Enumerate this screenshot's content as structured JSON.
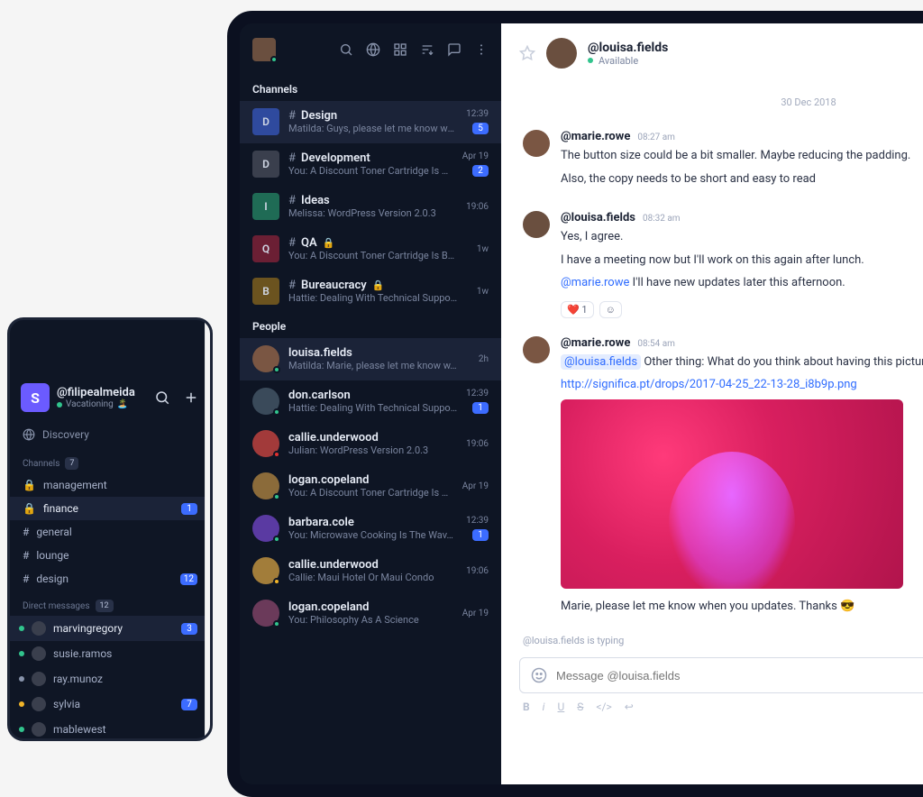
{
  "phone": {
    "workspace": {
      "initial": "S",
      "name": "@filipealmeida",
      "status": "Vacationing"
    },
    "discovery": "Discovery",
    "channels_label": "Channels",
    "channels_count": "7",
    "channels": [
      {
        "icon": "lock",
        "name": "management",
        "badge": ""
      },
      {
        "icon": "lock",
        "name": "finance",
        "badge": "1",
        "active": true
      },
      {
        "icon": "hash",
        "name": "general",
        "badge": ""
      },
      {
        "icon": "hash",
        "name": "lounge",
        "badge": ""
      },
      {
        "icon": "hash",
        "name": "design",
        "badge": "12"
      }
    ],
    "dm_label": "Direct messages",
    "dm_count": "12",
    "dms": [
      {
        "name": "marvingregory",
        "badge": "3",
        "dot": "#31c48d",
        "active": true
      },
      {
        "name": "susie.ramos",
        "badge": "",
        "dot": "#31c48d"
      },
      {
        "name": "ray.munoz",
        "badge": "",
        "dot": "#8893ab"
      },
      {
        "name": "sylvia",
        "badge": "7",
        "dot": "#f0b429"
      },
      {
        "name": "mablewest",
        "badge": "",
        "dot": "#31c48d"
      }
    ]
  },
  "sidebar": {
    "channels_label": "Channels",
    "people_label": "People",
    "channels": [
      {
        "letter": "D",
        "color": "#2f4a9e",
        "name": "Design",
        "preview": "Matilda: Guys, please let me know wh…",
        "time": "12:39",
        "badge": "5",
        "private": false,
        "sel": true
      },
      {
        "letter": "D",
        "color": "#3a3f4d",
        "name": "Development",
        "preview": "You: A Discount Toner Cartridge Is B…",
        "time": "Apr 19",
        "badge": "2",
        "private": false
      },
      {
        "letter": "I",
        "color": "#1f6b55",
        "name": "Ideas",
        "preview": "Melissa: WordPress Version 2.0.3",
        "time": "19:06",
        "badge": "",
        "private": false
      },
      {
        "letter": "Q",
        "color": "#6b1f34",
        "name": "QA",
        "preview": "You: A Discount Toner Cartridge Is B…",
        "time": "1w",
        "badge": "",
        "private": true
      },
      {
        "letter": "B",
        "color": "#6b531f",
        "name": "Bureaucracy",
        "preview": "Hattie: Dealing With Technical Suppo…",
        "time": "1w",
        "badge": "",
        "private": true
      }
    ],
    "people": [
      {
        "name": "louisa.fields",
        "preview": "Matilda: Marie, please let me know w…",
        "time": "2h",
        "badge": "",
        "av": "#7a5643",
        "dot": "#31c48d",
        "sel": true
      },
      {
        "name": "don.carlson",
        "preview": "Hattie: Dealing With Technical Support",
        "time": "12:39",
        "badge": "1",
        "av": "#3a4a5a",
        "dot": "#31c48d"
      },
      {
        "name": "callie.underwood",
        "preview": "Julian: WordPress Version 2.0.3",
        "time": "19:06",
        "badge": "",
        "av": "#a23a3a",
        "dot": "#e02f2f"
      },
      {
        "name": "logan.copeland",
        "preview": "You: A Discount Toner Cartridge Is B…",
        "time": "Apr 19",
        "badge": "",
        "av": "#8b6b3a",
        "dot": "#31c48d"
      },
      {
        "name": "barbara.cole",
        "preview": "You: Microwave Cooking Is The Wav…",
        "time": "12:39",
        "badge": "1",
        "av": "#5a3aa2",
        "dot": "#31c48d"
      },
      {
        "name": "callie.underwood",
        "preview": "Callie: Maui Hotel Or Maui Condo",
        "time": "19:06",
        "badge": "",
        "av": "#a27d3a",
        "dot": "#f0b429"
      },
      {
        "name": "logan.copeland",
        "preview": "You: Philosophy As A Science",
        "time": "Apr 19",
        "badge": "",
        "av": "#6b3a5a",
        "dot": "#31c48d"
      }
    ]
  },
  "conversation": {
    "name": "@louisa.fields",
    "status": "Available",
    "divider": "30 Dec 2018",
    "messages": [
      {
        "author": "@marie.rowe",
        "ts": "08:27 am",
        "av": "#7a5643",
        "lines": [
          "The button size could be a bit smaller. Maybe reducing the padding.",
          "Also, the copy needs to be short and easy to read"
        ]
      },
      {
        "author": "@louisa.fields",
        "ts": "08:32 am",
        "av": "#6a4f3f",
        "lines": [
          "Yes, I agree.",
          "I have a meeting now but I'll work on this again after lunch."
        ],
        "mention_line": {
          "mention": "@marie.rowe",
          "rest": " I'll have new updates later this afternoon."
        },
        "reaction": {
          "emoji": "❤️",
          "count": "1"
        }
      },
      {
        "author": "@marie.rowe",
        "ts": "08:54 am",
        "av": "#7a5643",
        "mention_hl": "@louisa.fields",
        "after_hl": " Other thing: What do you think about having this picture in t",
        "link": "http://significa.pt/drops/2017-04-25_22-13-28_i8b9p.png",
        "trailing": "Marie, please let me know when you updates. Thanks 😎"
      }
    ],
    "typing": "@louisa.fields is typing",
    "composer_placeholder": "Message @louisa.fields",
    "format_labels": {
      "b": "B",
      "i": "i",
      "u": "U",
      "s": "S",
      "code": "</>",
      "send": "↩"
    }
  }
}
